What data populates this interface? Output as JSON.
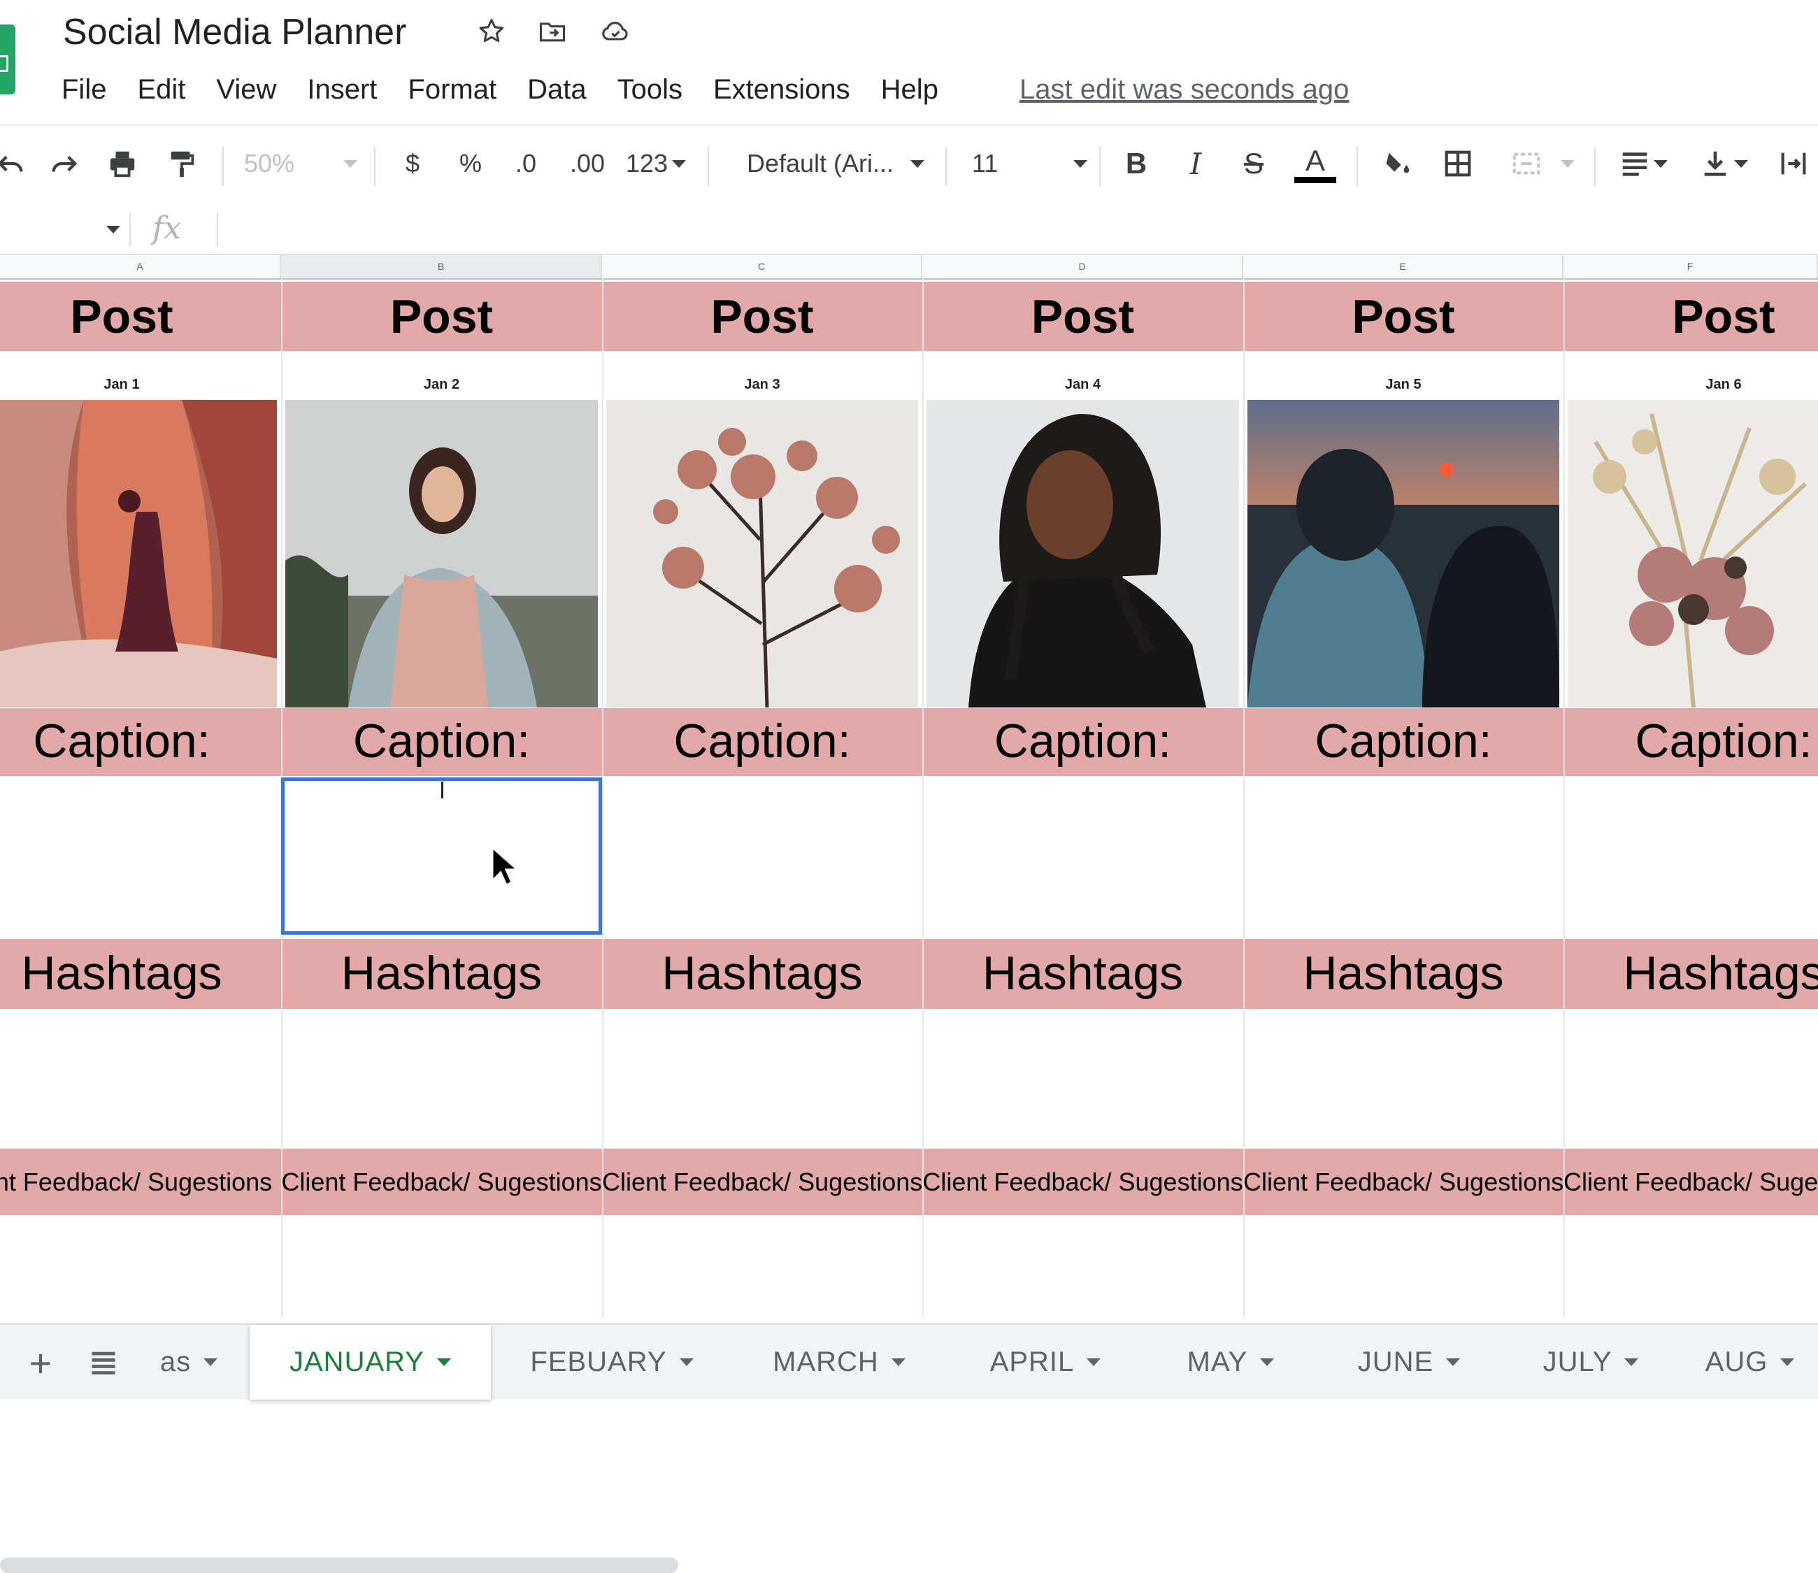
{
  "doc": {
    "title": "Social Media Planner"
  },
  "menu": [
    "File",
    "Edit",
    "View",
    "Insert",
    "Format",
    "Data",
    "Tools",
    "Extensions",
    "Help"
  ],
  "last_edit": "Last edit was seconds ago",
  "toolbar": {
    "zoom": "50%",
    "currency": "$",
    "percent": "%",
    "decrease_decimal": ".0",
    "increase_decimal": ".00",
    "number_format": "123",
    "font": "Default (Ari...",
    "font_size": "11",
    "bold": "B",
    "italic": "I",
    "strike": "S",
    "text_color": "A"
  },
  "columns": [
    {
      "letter": "A",
      "post": "Post",
      "date": "Jan 1",
      "caption": "Caption:",
      "hashtags": "Hashtags",
      "feedback": "Client Feedback/ Sugestions"
    },
    {
      "letter": "B",
      "post": "Post",
      "date": "Jan 2",
      "caption": "Caption:",
      "hashtags": "Hashtags",
      "feedback": "Client Feedback/ Sugestions"
    },
    {
      "letter": "C",
      "post": "Post",
      "date": "Jan 3",
      "caption": "Caption:",
      "hashtags": "Hashtags",
      "feedback": "Client Feedback/ Sugestions"
    },
    {
      "letter": "D",
      "post": "Post",
      "date": "Jan 4",
      "caption": "Caption:",
      "hashtags": "Hashtags",
      "feedback": "Client Feedback/ Sugestions"
    },
    {
      "letter": "E",
      "post": "Post",
      "date": "Jan 5",
      "caption": "Caption:",
      "hashtags": "Hashtags",
      "feedback": "Client Feedback/ Sugestions"
    },
    {
      "letter": "F",
      "post": "Post",
      "date": "Jan 6",
      "caption": "Caption:",
      "hashtags": "Hashtags",
      "feedback": "Client Feedback/ Sugestions"
    }
  ],
  "tabs": [
    {
      "label": "as"
    },
    {
      "label": "JANUARY",
      "active": true
    },
    {
      "label": "FEBUARY"
    },
    {
      "label": "MARCH"
    },
    {
      "label": "APRIL"
    },
    {
      "label": "MAY"
    },
    {
      "label": "JUNE"
    },
    {
      "label": "JULY"
    },
    {
      "label": "AUG"
    }
  ],
  "colors": {
    "band": "#e2a9a8",
    "selection": "#3e74d6",
    "active_tab": "#188038",
    "sheets_green": "#23a566"
  },
  "icons": [
    "star-icon",
    "move-to-folder-icon",
    "cloud-status-icon",
    "undo-icon",
    "redo-icon",
    "print-icon",
    "paint-format-icon",
    "fill-color-icon",
    "borders-icon",
    "merge-cells-icon",
    "align-left-icon",
    "vertical-align-icon",
    "text-direction-icon",
    "add-sheet-icon",
    "all-sheets-icon",
    "mouse-pointer-icon"
  ]
}
